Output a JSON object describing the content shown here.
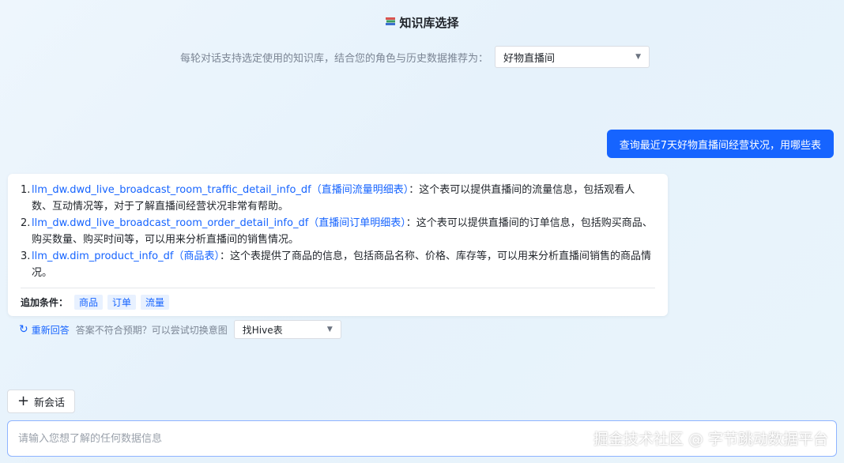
{
  "header": {
    "title": "知识库选择",
    "icon": "book-stack-icon"
  },
  "kb_select": {
    "hint": "每轮对话支持选定使用的知识库，结合您的角色与历史数据推荐为：",
    "value": "好物直播间"
  },
  "user_message": "查询最近7天好物直播间经营状况，用哪些表",
  "answer": {
    "items": [
      {
        "num": "1.",
        "table": "llm_dw.dwd_live_broadcast_room_traffic_detail_info_df（直播间流量明细表）",
        "desc": "：这个表可以提供直播间的流量信息，包括观看人数、互动情况等，对于了解直播间经营状况非常有帮助。"
      },
      {
        "num": "2.",
        "table": "llm_dw.dwd_live_broadcast_room_order_detail_info_df（直播间订单明细表）",
        "desc": "：这个表可以提供直播间的订单信息，包括购买商品、购买数量、购买时间等，可以用来分析直播间的销售情况。"
      },
      {
        "num": "3.",
        "table": "llm_dw.dim_product_info_df（商品表）",
        "desc": "：这个表提供了商品的信息，包括商品名称、价格、库存等，可以用来分析直播间销售的商品情况。"
      }
    ],
    "tag_label": "追加条件：",
    "tags": [
      "商品",
      "订单",
      "流量"
    ]
  },
  "regen": {
    "label": "重新回答",
    "hint": "答案不符合预期？可以尝试切换意图",
    "intent_value": "找Hive表"
  },
  "new_chat_label": "新会话",
  "input": {
    "placeholder": "请输入您想了解的任何数据信息"
  },
  "watermark": "掘金技术社区 @ 字节跳动数据平台",
  "colors": {
    "accent": "#1664ff",
    "tag_bg": "#e8f1ff"
  }
}
